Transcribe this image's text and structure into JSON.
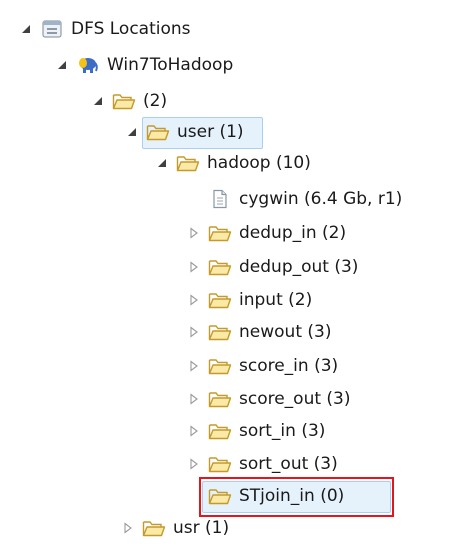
{
  "tree": {
    "root": {
      "label": "DFS Locations",
      "icon": "dfs-locations-icon",
      "expanded": true
    },
    "location": {
      "label": "Win7ToHadoop",
      "icon": "hadoop-elephant-icon",
      "expanded": true
    },
    "dir_root": {
      "label": "(2)",
      "icon": "folder-icon",
      "expanded": true
    },
    "user": {
      "label": "user (1)",
      "icon": "folder-icon",
      "expanded": true,
      "selected": true
    },
    "hadoop": {
      "label": "hadoop (10)",
      "icon": "folder-icon",
      "expanded": true
    },
    "children": [
      {
        "label": "cygwin (6.4 Gb, r1)",
        "icon": "file-icon",
        "expandable": false
      },
      {
        "label": "dedup_in (2)",
        "icon": "folder-icon",
        "expandable": true
      },
      {
        "label": "dedup_out (3)",
        "icon": "folder-icon",
        "expandable": true
      },
      {
        "label": "input (2)",
        "icon": "folder-icon",
        "expandable": true
      },
      {
        "label": "newout (3)",
        "icon": "folder-icon",
        "expandable": true
      },
      {
        "label": "score_in (3)",
        "icon": "folder-icon",
        "expandable": true
      },
      {
        "label": "score_out (3)",
        "icon": "folder-icon",
        "expandable": true
      },
      {
        "label": "sort_in (3)",
        "icon": "folder-icon",
        "expandable": true
      },
      {
        "label": "sort_out (3)",
        "icon": "folder-icon",
        "expandable": true
      },
      {
        "label": "STjoin_in (0)",
        "icon": "folder-icon",
        "expandable": false,
        "highlighted": true
      }
    ],
    "usr": {
      "label": "usr (1)",
      "icon": "folder-icon",
      "expandable": true
    }
  },
  "colors": {
    "highlight_box": "#e8141b",
    "selection_bg": "#e6f2fb",
    "folder_stroke": "#c49a28",
    "folder_fill": "#fbe9a8"
  }
}
